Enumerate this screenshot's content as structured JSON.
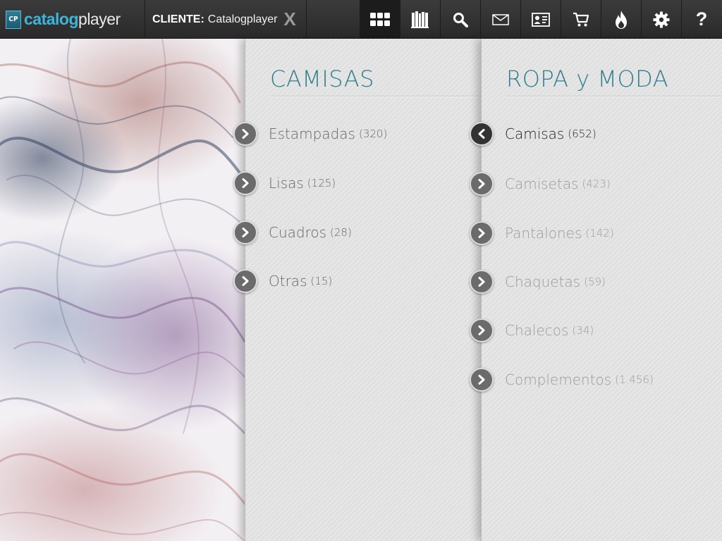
{
  "app": {
    "logo_badge": "CP",
    "logo_part1": "catalog",
    "logo_part2": "player"
  },
  "client": {
    "label": "CLIENTE:",
    "name": "Catalogplayer",
    "close_glyph": "X"
  },
  "toolbar": {
    "icons": [
      "grid-icon",
      "catalogs-icon",
      "search-icon",
      "mail-icon",
      "contact-card-icon",
      "cart-icon",
      "fire-icon",
      "settings-icon",
      "help-icon"
    ],
    "help_glyph": "?",
    "active_icon": "grid-icon"
  },
  "column1": {
    "title": "CAMISAS",
    "items": [
      {
        "label": "Estampadas",
        "count": "(320)"
      },
      {
        "label": "Lisas",
        "count": "(125)"
      },
      {
        "label": "Cuadros",
        "count": "(28)"
      },
      {
        "label": "Otras",
        "count": "(15)"
      }
    ]
  },
  "column2": {
    "title": "ROPA y MODA",
    "items": [
      {
        "label": "Camisas",
        "count": "(652)",
        "state": "selected"
      },
      {
        "label": "Camisetas",
        "count": "(423)"
      },
      {
        "label": "Pantalones",
        "count": "(142)"
      },
      {
        "label": "Chaquetas",
        "count": "(59)"
      },
      {
        "label": "Chalecos",
        "count": "(34)"
      },
      {
        "label": "Complementos",
        "count": "(1.456)"
      }
    ]
  },
  "colors": {
    "accent": "#2f7f8c",
    "logo_accent": "#3bb6da",
    "topbar": "#2e2e2e"
  }
}
